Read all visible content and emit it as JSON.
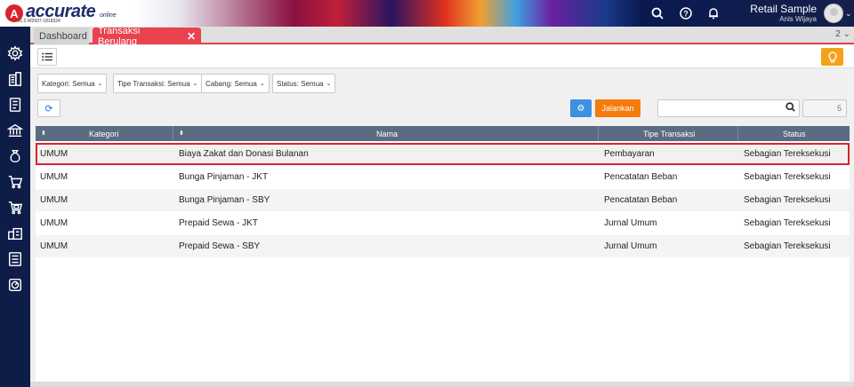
{
  "header": {
    "logo_text": "accurate",
    "logo_sub": "online",
    "version": "v1.0.W2937-1818324",
    "company": "Retail Sample",
    "user": "Anis Wijaya"
  },
  "tabs": [
    {
      "label": "Dashboard"
    },
    {
      "label": "Transaksi Berulang"
    }
  ],
  "tab_count": "2",
  "filters": [
    {
      "label": "Kategori: Semua"
    },
    {
      "label": "Tipe Transaksi: Semua"
    },
    {
      "label": "Cabang: Semua"
    },
    {
      "label": "Status: Semua"
    }
  ],
  "actions": {
    "run_label": "Jalankan",
    "search_value": "",
    "record_count": "5"
  },
  "table": {
    "columns": [
      "Kategori",
      "Nama",
      "Tipe Transaksi",
      "Status"
    ],
    "rows": [
      [
        "UMUM",
        "Biaya Zakat dan Donasi Bulanan",
        "Pembayaran",
        "Sebagian Tereksekusi"
      ],
      [
        "UMUM",
        "Bunga Pinjaman - JKT",
        "Pencatatan Beban",
        "Sebagian Tereksekusi"
      ],
      [
        "UMUM",
        "Bunga Pinjaman - SBY",
        "Pencatatan Beban",
        "Sebagian Tereksekusi"
      ],
      [
        "UMUM",
        "Prepaid Sewa - JKT",
        "Jurnal Umum",
        "Sebagian Tereksekusi"
      ],
      [
        "UMUM",
        "Prepaid Sewa - SBY",
        "Jurnal Umum",
        "Sebagian Tereksekusi"
      ]
    ]
  },
  "colors": {
    "accent": "#e8434f",
    "sidebar": "#0e1c48",
    "header_grid": "#5b6b82",
    "run_button": "#f57c0c",
    "gear_button": "#3d8fe0",
    "bulb_button": "#f5a21b"
  }
}
